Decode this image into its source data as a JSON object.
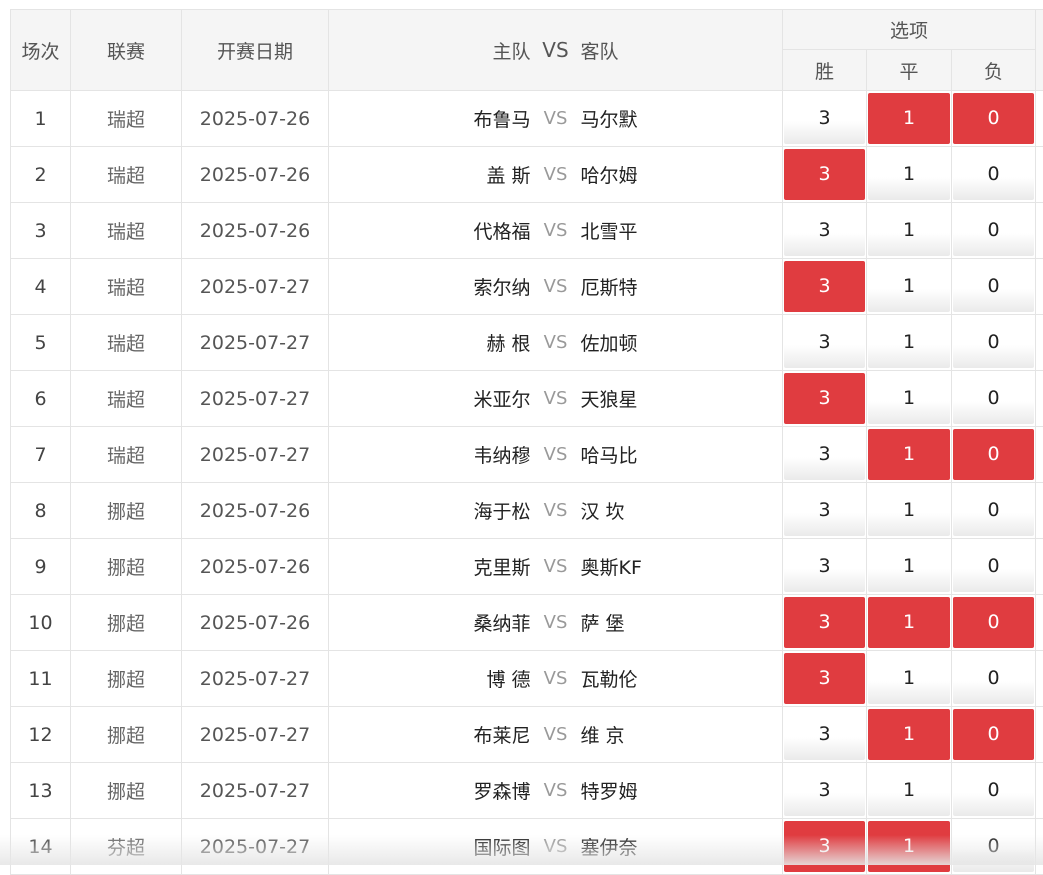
{
  "header": {
    "round": "场次",
    "league": "联赛",
    "date": "开赛日期",
    "home": "主队",
    "vs": "VS",
    "away": "客队",
    "options": "选项",
    "win": "胜",
    "draw": "平",
    "lose": "负"
  },
  "colors": {
    "selected": "#e03c40",
    "border": "#e4e4e4",
    "header_bg": "#f5f5f5"
  },
  "rows": [
    {
      "num": "1",
      "league": "瑞超",
      "date": "2025-07-26",
      "home": "布鲁马",
      "vs": "VS",
      "away": "马尔默",
      "win": "3",
      "draw": "1",
      "lose": "0",
      "sel": [
        false,
        true,
        true
      ]
    },
    {
      "num": "2",
      "league": "瑞超",
      "date": "2025-07-26",
      "home": "盖 斯",
      "vs": "VS",
      "away": "哈尔姆",
      "win": "3",
      "draw": "1",
      "lose": "0",
      "sel": [
        true,
        false,
        false
      ]
    },
    {
      "num": "3",
      "league": "瑞超",
      "date": "2025-07-26",
      "home": "代格福",
      "vs": "VS",
      "away": "北雪平",
      "win": "3",
      "draw": "1",
      "lose": "0",
      "sel": [
        false,
        false,
        false
      ]
    },
    {
      "num": "4",
      "league": "瑞超",
      "date": "2025-07-27",
      "home": "索尔纳",
      "vs": "VS",
      "away": "厄斯特",
      "win": "3",
      "draw": "1",
      "lose": "0",
      "sel": [
        true,
        false,
        false
      ]
    },
    {
      "num": "5",
      "league": "瑞超",
      "date": "2025-07-27",
      "home": "赫 根",
      "vs": "VS",
      "away": "佐加顿",
      "win": "3",
      "draw": "1",
      "lose": "0",
      "sel": [
        false,
        false,
        false
      ]
    },
    {
      "num": "6",
      "league": "瑞超",
      "date": "2025-07-27",
      "home": "米亚尔",
      "vs": "VS",
      "away": "天狼星",
      "win": "3",
      "draw": "1",
      "lose": "0",
      "sel": [
        true,
        false,
        false
      ]
    },
    {
      "num": "7",
      "league": "瑞超",
      "date": "2025-07-27",
      "home": "韦纳穆",
      "vs": "VS",
      "away": "哈马比",
      "win": "3",
      "draw": "1",
      "lose": "0",
      "sel": [
        false,
        true,
        true
      ]
    },
    {
      "num": "8",
      "league": "挪超",
      "date": "2025-07-26",
      "home": "海于松",
      "vs": "VS",
      "away": "汉 坎",
      "win": "3",
      "draw": "1",
      "lose": "0",
      "sel": [
        false,
        false,
        false
      ]
    },
    {
      "num": "9",
      "league": "挪超",
      "date": "2025-07-26",
      "home": "克里斯",
      "vs": "VS",
      "away": "奥斯KF",
      "win": "3",
      "draw": "1",
      "lose": "0",
      "sel": [
        false,
        false,
        false
      ]
    },
    {
      "num": "10",
      "league": "挪超",
      "date": "2025-07-26",
      "home": "桑纳菲",
      "vs": "VS",
      "away": "萨 堡",
      "win": "3",
      "draw": "1",
      "lose": "0",
      "sel": [
        true,
        true,
        true
      ]
    },
    {
      "num": "11",
      "league": "挪超",
      "date": "2025-07-27",
      "home": "博 德",
      "vs": "VS",
      "away": "瓦勒伦",
      "win": "3",
      "draw": "1",
      "lose": "0",
      "sel": [
        true,
        false,
        false
      ]
    },
    {
      "num": "12",
      "league": "挪超",
      "date": "2025-07-27",
      "home": "布莱尼",
      "vs": "VS",
      "away": "维 京",
      "win": "3",
      "draw": "1",
      "lose": "0",
      "sel": [
        false,
        true,
        true
      ]
    },
    {
      "num": "13",
      "league": "挪超",
      "date": "2025-07-27",
      "home": "罗森博",
      "vs": "VS",
      "away": "特罗姆",
      "win": "3",
      "draw": "1",
      "lose": "0",
      "sel": [
        false,
        false,
        false
      ]
    },
    {
      "num": "14",
      "league": "芬超",
      "date": "2025-07-27",
      "home": "国际图",
      "vs": "VS",
      "away": "塞伊奈",
      "win": "3",
      "draw": "1",
      "lose": "0",
      "sel": [
        true,
        true,
        false
      ]
    }
  ]
}
